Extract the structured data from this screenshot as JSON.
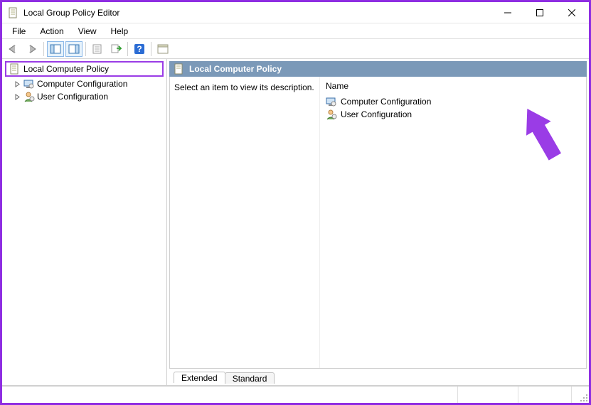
{
  "window": {
    "title": "Local Group Policy Editor"
  },
  "menu": {
    "file": "File",
    "action": "Action",
    "view": "View",
    "help": "Help"
  },
  "tree": {
    "root": "Local Computer Policy",
    "children": [
      "Computer Configuration",
      "User Configuration"
    ]
  },
  "detail": {
    "heading": "Local Computer Policy",
    "description": "Select an item to view its description.",
    "column_name": "Name",
    "items": [
      "Computer Configuration",
      "User Configuration"
    ]
  },
  "tabs": {
    "extended": "Extended",
    "standard": "Standard"
  },
  "colors": {
    "highlight_border": "#9a3ce6",
    "cursor": "#9a3ce6",
    "header_bg": "#7b99b8"
  }
}
